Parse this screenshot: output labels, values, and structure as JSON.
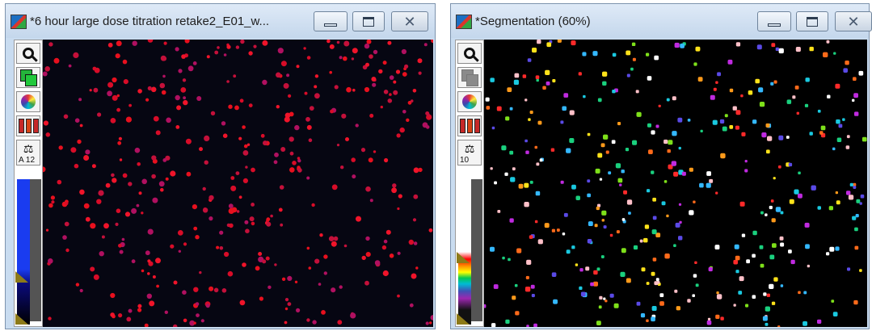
{
  "window1": {
    "title": "*6 hour large dose titration retake2_E01_w...",
    "tools": [
      "zoom-tool",
      "select-tool",
      "color-tool",
      "channels-tool",
      "calibration-tool"
    ],
    "scale_text": "A 12",
    "accent": "#e8101e"
  },
  "window2": {
    "title": "*Segmentation (60%)",
    "tools": [
      "zoom-tool",
      "select-tool",
      "color-tool",
      "channels-tool",
      "calibration-tool"
    ],
    "scale_text": "10"
  }
}
